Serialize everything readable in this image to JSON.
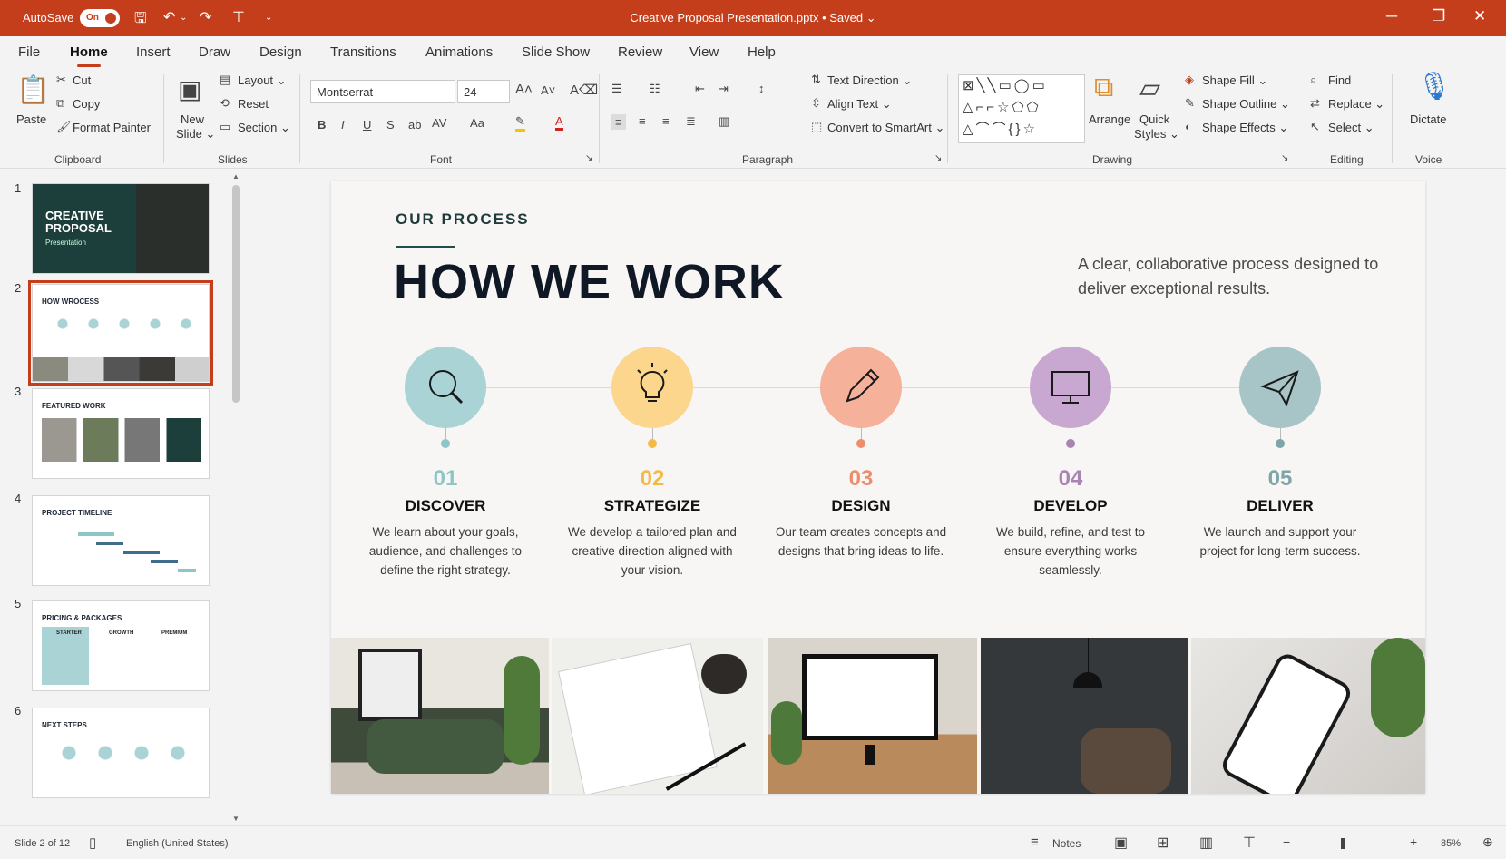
{
  "titlebar": {
    "autosave": "AutoSave",
    "toggle": "On",
    "doc_title": "Creative Proposal Presentation.pptx • Saved ⌄"
  },
  "tabs": [
    "File",
    "Home",
    "Insert",
    "Draw",
    "Design",
    "Transitions",
    "Animations",
    "Slide Show",
    "Review",
    "View",
    "Help"
  ],
  "ribbon": {
    "clipboard": {
      "paste": "Paste",
      "cut": "Cut",
      "copy": "Copy",
      "format_painter": "Format Painter",
      "label": "Clipboard"
    },
    "slides": {
      "new_slide": "New",
      "new_slide2": "Slide ⌄",
      "layout": "Layout ⌄",
      "reset": "Reset",
      "section": "Section ⌄",
      "label": "Slides"
    },
    "font": {
      "family": "Montserrat",
      "size": "24",
      "label": "Font"
    },
    "paragraph": {
      "text_direction": "Text Direction ⌄",
      "align_text": "Align Text ⌄",
      "smartart": "Convert to SmartArt ⌄",
      "label": "Paragraph"
    },
    "drawing": {
      "arrange": "Arrange",
      "quick_styles": "Quick",
      "quick_styles2": "Styles ⌄",
      "shape_fill": "Shape Fill ⌄",
      "shape_outline": "Shape Outline ⌄",
      "shape_effects": "Shape Effects ⌄",
      "label": "Drawing"
    },
    "editing": {
      "find": "Find",
      "replace": "Replace ⌄",
      "select": "Select ⌄",
      "label": "Editing"
    },
    "voice": {
      "dictate": "Dictate",
      "label": "Voice"
    }
  },
  "thumbnails": [
    {
      "num": "1",
      "title": "CREATIVE PROPOSAL",
      "sub": "Presentation"
    },
    {
      "num": "2",
      "title": "HOW WROCESS"
    },
    {
      "num": "3",
      "title": "FEATURED WORK"
    },
    {
      "num": "4",
      "title": "PROJECT TIMELINE"
    },
    {
      "num": "5",
      "title": "PRICING & PACKAGES",
      "cols": [
        "STARTER",
        "GROWTH",
        "PREMIUM"
      ]
    },
    {
      "num": "6",
      "title": "NEXT STEPS"
    }
  ],
  "slide": {
    "eyebrow": "OUR PROCESS",
    "headline": "HOW WE WORK",
    "lede": "A clear, collaborative process designed to deliver exceptional results.",
    "steps": [
      {
        "num": "01",
        "name": "DISCOVER",
        "desc": "We learn about your goals, audience, and challenges to define the right strategy.",
        "icon": "search-icon",
        "color": "#a9d3d4",
        "accent": "#8ec5c6"
      },
      {
        "num": "02",
        "name": "STRATEGIZE",
        "desc": "We develop a tailored plan and creative direction aligned with your vision.",
        "icon": "lightbulb-icon",
        "color": "#fbd68c",
        "accent": "#f5b945"
      },
      {
        "num": "03",
        "name": "DESIGN",
        "desc": "Our team creates concepts and designs that bring ideas to life.",
        "icon": "pencil-icon",
        "color": "#f5b19a",
        "accent": "#ee8d6c"
      },
      {
        "num": "04",
        "name": "DEVELOP",
        "desc": "We build, refine, and test to ensure everything works seamlessly.",
        "icon": "monitor-icon",
        "color": "#c8a8d0",
        "accent": "#a884b3"
      },
      {
        "num": "05",
        "name": "DELIVER",
        "desc": "We launch and support your project for long-term success.",
        "icon": "paper-plane-icon",
        "color": "#a7c4c6",
        "accent": "#7fa5a8"
      }
    ]
  },
  "status": {
    "slide": "Slide 2 of 12",
    "language": "English (United States)",
    "notes": "Notes",
    "zoom": "85%"
  }
}
